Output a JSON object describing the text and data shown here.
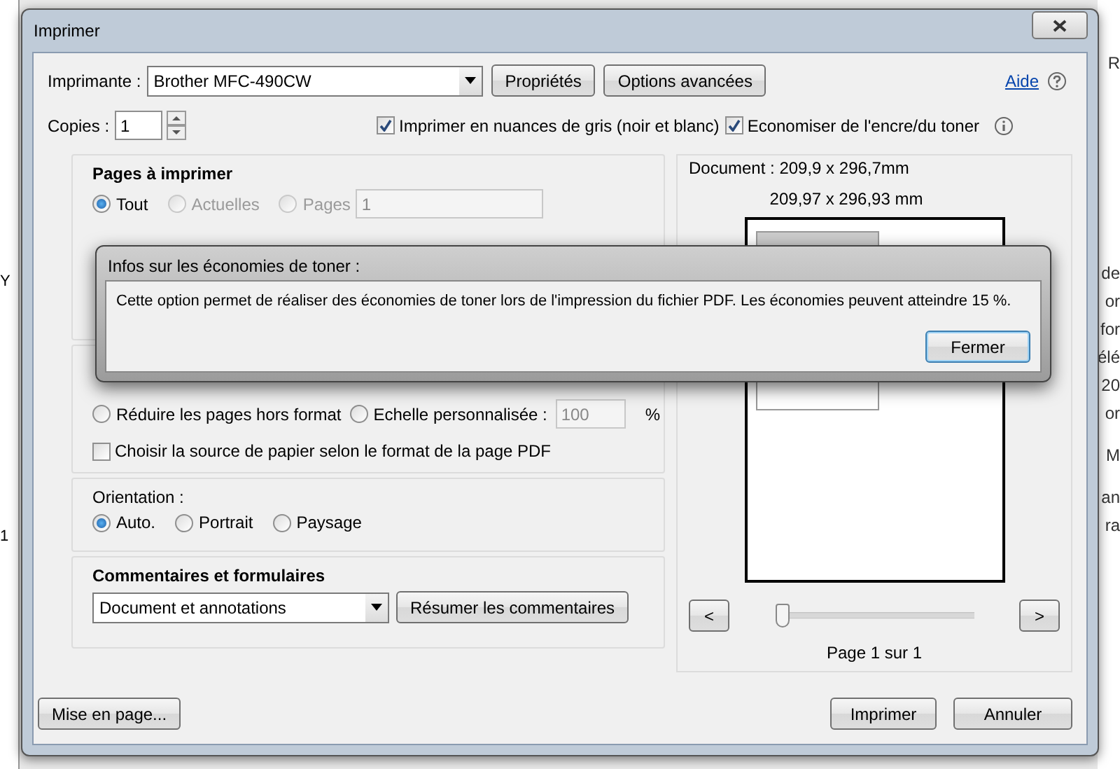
{
  "window": {
    "title": "Imprimer"
  },
  "printer": {
    "label": "Imprimante :",
    "value": "Brother MFC-490CW"
  },
  "top_buttons": [
    {
      "label": "Propriétés"
    },
    {
      "label": "Options avancées"
    }
  ],
  "help": {
    "label": "Aide"
  },
  "copies": {
    "label": "Copies :",
    "value": "1"
  },
  "options": [
    {
      "label": "Imprimer en nuances de gris (noir et blanc)",
      "checked": true
    },
    {
      "label": "Economiser de l'encre/du toner",
      "checked": true
    }
  ],
  "pages_section": {
    "title": "Pages à imprimer",
    "choices": [
      {
        "label": "Tout",
        "selected": true,
        "disabled": false
      },
      {
        "label": "Actuelles",
        "selected": false,
        "disabled": true
      },
      {
        "label": "Pages",
        "selected": false,
        "disabled": true
      }
    ],
    "range": "1"
  },
  "size_section": {
    "choices": [
      {
        "label": "Réduire les pages hors format",
        "selected": false
      },
      {
        "label": "Echelle personnalisée :",
        "selected": false
      }
    ],
    "scale": "100",
    "unit": "%",
    "paper_source": {
      "label": "Choisir la source de papier selon le format de la page PDF",
      "checked": false
    }
  },
  "orientation": {
    "title": "Orientation :",
    "choices": [
      {
        "label": "Auto.",
        "selected": true
      },
      {
        "label": "Portrait",
        "selected": false
      },
      {
        "label": "Paysage",
        "selected": false
      }
    ]
  },
  "comments": {
    "title": "Commentaires et formulaires",
    "value": "Document et annotations",
    "button": "Résumer les commentaires"
  },
  "preview": {
    "document_size": "Document : 209,9 x 296,7mm",
    "page_size": "209,97 x 296,93 mm",
    "prev": "<",
    "next": ">",
    "slider": {
      "level": 0
    },
    "page_label": "Page 1 sur 1"
  },
  "page_setup": "Mise en page...",
  "actions": [
    {
      "label": "Imprimer"
    },
    {
      "label": "Annuler"
    }
  ],
  "popup": {
    "title": "Infos sur les économies de toner :",
    "message": "Cette option permet de réaliser des économies de toner lors de l'impression du fichier PDF. Les économies peuvent atteindre 15 %.",
    "button": "Fermer"
  },
  "background": {
    "left_fragments": [
      "Y",
      "1"
    ],
    "right_fragments": [
      "R",
      "de",
      "or",
      "for",
      "élé",
      "20",
      "or",
      "M",
      "an",
      "ra"
    ]
  }
}
